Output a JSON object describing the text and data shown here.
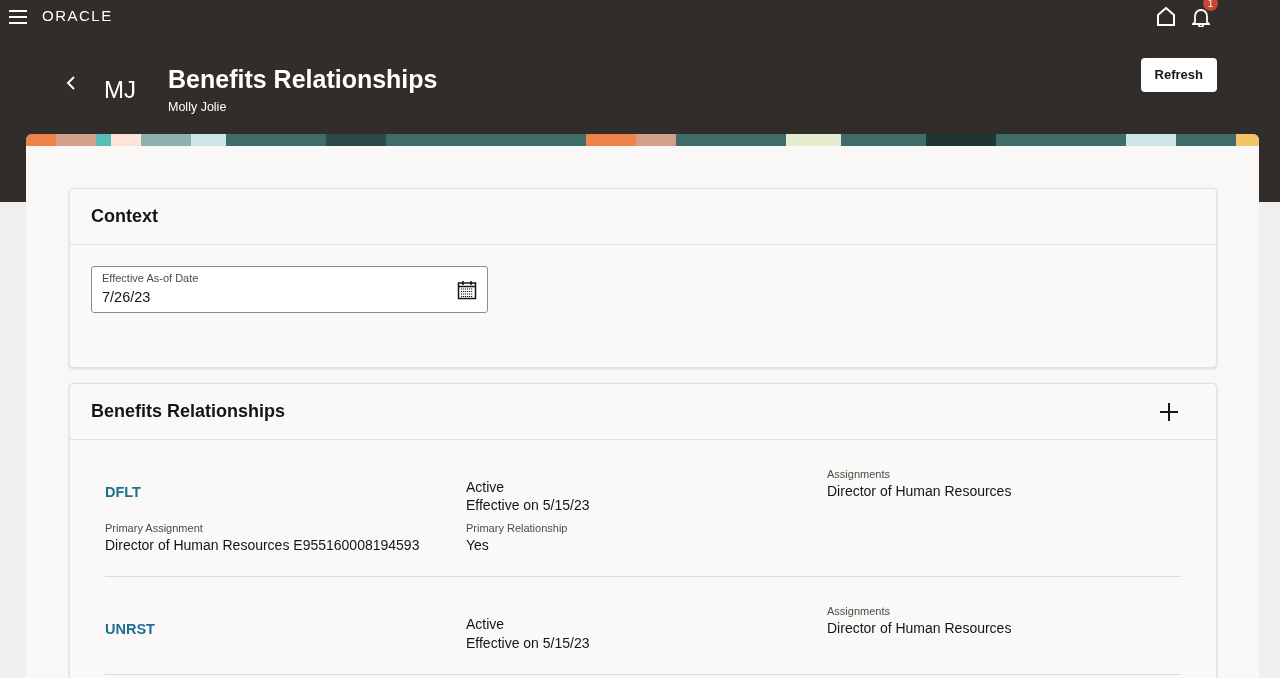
{
  "top_bar": {
    "brand": "ORACLE",
    "notification_count": "1"
  },
  "page_header": {
    "initials": "MJ",
    "title": "Benefits Relationships",
    "subtitle": "Molly Jolie",
    "refresh_button": "Refresh"
  },
  "context": {
    "title": "Context",
    "date_field": {
      "label": "Effective As-of Date",
      "value": "7/26/23"
    }
  },
  "relationships": {
    "title": "Benefits Relationships",
    "items": [
      {
        "code": "DFLT",
        "status": "Active",
        "effective": "Effective on 5/15/23",
        "assignments_label": "Assignments",
        "assignments_value": "Director of Human Resources",
        "primary_assignment_label": "Primary Assignment",
        "primary_assignment_value": "Director of Human Resources E955160008194593",
        "primary_relationship_label": "Primary Relationship",
        "primary_relationship_value": "Yes"
      },
      {
        "code": "UNRST",
        "status": "Active",
        "effective": "Effective on 5/15/23",
        "assignments_label": "Assignments",
        "assignments_value": "Director of Human Resources"
      }
    ]
  }
}
